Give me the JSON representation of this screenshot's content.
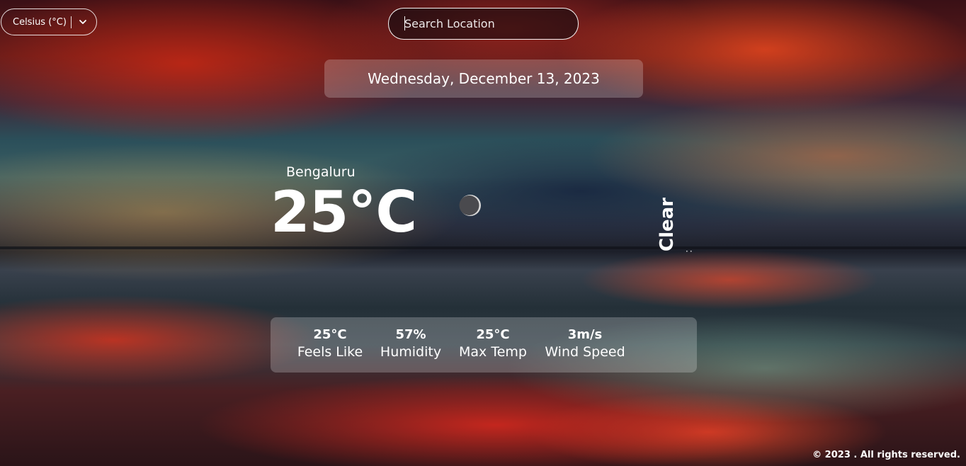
{
  "units": {
    "selected": "Celsius (°C)"
  },
  "search": {
    "placeholder": "Search Location"
  },
  "date": "Wednesday, December 13, 2023",
  "weather": {
    "city": "Bengaluru",
    "temperature": "25°C",
    "condition": "Clear",
    "icon": "moon-icon"
  },
  "stats": [
    {
      "value": "25°C",
      "label": "Feels Like"
    },
    {
      "value": "57%",
      "label": "Humidity"
    },
    {
      "value": "25°C",
      "label": "Max Temp"
    },
    {
      "value": "3m/s",
      "label": "Wind Speed"
    }
  ],
  "footer": "© 2023 . All rights reserved."
}
